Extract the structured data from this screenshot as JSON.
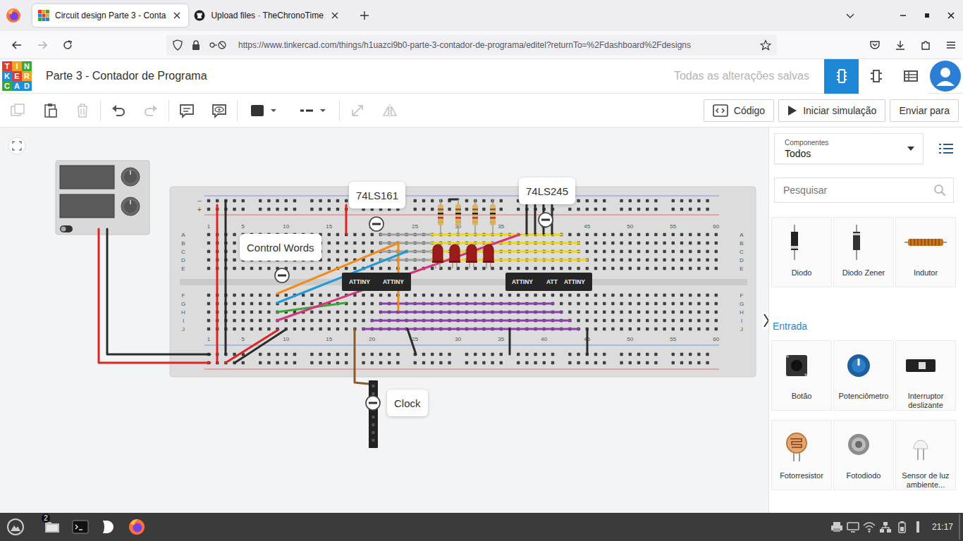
{
  "browser": {
    "tabs": [
      {
        "label": "Circuit design Parte 3 - Conta",
        "kind": "tinkercad",
        "selected": true
      },
      {
        "label": "Upload files · TheChronoTime",
        "kind": "github",
        "selected": false
      }
    ],
    "url": "https://www.tinkercad.com/things/h1uazci9b0-parte-3-contador-de-programa/editel?returnTo=%2Fdashboard%2Fdesigns"
  },
  "app": {
    "logo": [
      "T",
      "I",
      "N",
      "K",
      "E",
      "R",
      "C",
      "A",
      "D"
    ],
    "title": "Parte 3 - Contador de Programa",
    "save_status": "Todas as alterações salvas",
    "views": [
      {
        "kind": "circuit",
        "selected": true
      },
      {
        "kind": "schematic",
        "selected": false
      },
      {
        "kind": "list",
        "selected": false
      }
    ]
  },
  "toolbar": {
    "tools": [
      {
        "kind": "copy",
        "disabled": true
      },
      {
        "kind": "paste",
        "disabled": false
      },
      {
        "kind": "delete",
        "disabled": true
      },
      {
        "kind": "undo",
        "disabled": false
      },
      {
        "kind": "redo",
        "disabled": true
      },
      {
        "kind": "note",
        "disabled": false
      },
      {
        "kind": "notes-visibility",
        "disabled": false
      },
      {
        "kind": "color",
        "disabled": false
      },
      {
        "kind": "line-style",
        "disabled": false
      },
      {
        "kind": "rotate",
        "disabled": true
      },
      {
        "kind": "flip",
        "disabled": true
      }
    ],
    "buttons": [
      {
        "label": "Código",
        "kind": "code"
      },
      {
        "label": "Iniciar simulação",
        "kind": "play"
      },
      {
        "label": "Enviar para",
        "kind": "plain"
      }
    ]
  },
  "canvas": {
    "columns": [
      "1",
      "5",
      "10",
      "15",
      "20",
      "25",
      "30",
      "35",
      "40",
      "45",
      "50",
      "55",
      "60"
    ],
    "rows_top": [
      "A",
      "B",
      "C",
      "D",
      "E"
    ],
    "rows_bottom": [
      "F",
      "G",
      "H",
      "I",
      "J"
    ],
    "rail_signs": [
      "−",
      "+"
    ],
    "chips": [
      {
        "labels": [
          "ATTINY",
          "ATTINY"
        ]
      },
      {
        "labels": [
          "ATTINY",
          "ATT",
          "ATTINY"
        ]
      }
    ],
    "notes": [
      {
        "text": "74LS161"
      },
      {
        "text": "Control Words"
      },
      {
        "text": "74LS245"
      },
      {
        "text": "Clock"
      }
    ],
    "wires": [
      {
        "color": "#a0a0a0"
      },
      {
        "color": "#a0a0a0"
      },
      {
        "color": "#a0a0a0"
      },
      {
        "color": "#a0a0a0"
      },
      {
        "color": "#f2d60c"
      },
      {
        "color": "#f2d60c"
      },
      {
        "color": "#f2d60c"
      },
      {
        "color": "#f2d60c"
      },
      {
        "color": "#8e3fb0"
      },
      {
        "color": "#8e3fb0"
      },
      {
        "color": "#8e3fb0"
      },
      {
        "color": "#8e3fb0"
      },
      {
        "color": "#e02424"
      },
      {
        "color": "#2b2b2b"
      },
      {
        "color": "#e02424"
      },
      {
        "color": "#2b2b2b"
      },
      {
        "color": "#e02424"
      },
      {
        "color": "#2b2b2b"
      },
      {
        "color": "#f08c1a"
      },
      {
        "color": "#f08c1a"
      },
      {
        "color": "#1f9ad6"
      },
      {
        "color": "#38a836"
      },
      {
        "color": "#d8327c"
      },
      {
        "color": "#e02424"
      },
      {
        "color": "#8b5a2b"
      },
      {
        "color": "#2b2b2b"
      },
      {
        "color": "#2b2b2b"
      },
      {
        "color": "#2b2b2b"
      },
      {
        "color": "#2b2b2b"
      },
      {
        "color": "#2b2b2b"
      },
      {
        "color": "#2b2b2b"
      },
      {
        "color": "#2b2b2b"
      },
      {
        "color": "#2b2b2b"
      }
    ]
  },
  "panel": {
    "category_label": "Componentes",
    "category": "Todos",
    "search_placeholder": "Pesquisar",
    "components": [
      {
        "label": "Diodo",
        "kind": "diode"
      },
      {
        "label": "Diodo Zener",
        "kind": "zener"
      },
      {
        "label": "Indutor",
        "kind": "inductor"
      }
    ],
    "section": "Entrada",
    "inputs": [
      {
        "label": "Botão",
        "kind": "button"
      },
      {
        "label": "Potenciômetro",
        "kind": "pot"
      },
      {
        "label": "Interruptor deslizante",
        "kind": "slide"
      },
      {
        "label": "Fotorresistor",
        "kind": "ldr"
      },
      {
        "label": "Fotodiodo",
        "kind": "photodiode"
      },
      {
        "label": "Sensor de luz ambiente...",
        "kind": "ambient"
      }
    ]
  },
  "taskbar": {
    "badge": "2",
    "time": "21:17"
  }
}
